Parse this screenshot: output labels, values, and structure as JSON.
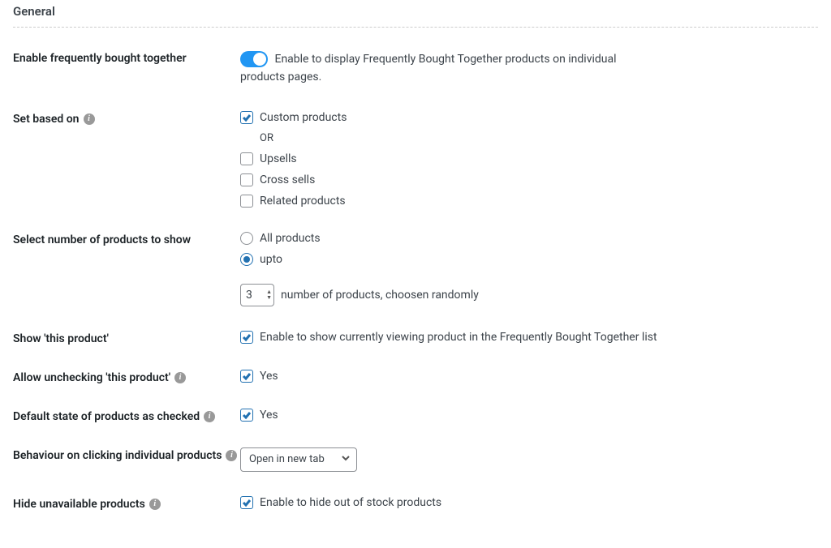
{
  "section_title": "General",
  "fields": {
    "enable_fbt": {
      "label": "Enable frequently bought together",
      "enabled": true,
      "description": "Enable to display Frequently Bought Together products on individual products pages."
    },
    "set_based_on": {
      "label": "Set based on",
      "options": {
        "custom": {
          "label": "Custom products",
          "checked": true
        },
        "or_text": "OR",
        "upsells": {
          "label": "Upsells",
          "checked": false
        },
        "cross_sells": {
          "label": "Cross sells",
          "checked": false
        },
        "related": {
          "label": "Related products",
          "checked": false
        }
      }
    },
    "select_number": {
      "label": "Select number of products to show",
      "options": {
        "all": {
          "label": "All products",
          "selected": false
        },
        "upto": {
          "label": "upto",
          "selected": true
        }
      },
      "number_value": "3",
      "number_suffix": "number of products, choosen randomly"
    },
    "show_this": {
      "label": "Show 'this product'",
      "checked": true,
      "text": "Enable to show currently viewing product in the Frequently Bought Together list"
    },
    "allow_uncheck": {
      "label": "Allow unchecking 'this product'",
      "checked": true,
      "text": "Yes"
    },
    "default_checked": {
      "label": "Default state of products as checked",
      "checked": true,
      "text": "Yes"
    },
    "click_behaviour": {
      "label": "Behaviour on clicking individual products",
      "selected": "Open in new tab"
    },
    "hide_unavailable": {
      "label": "Hide unavailable products",
      "checked": true,
      "text": "Enable to hide out of stock products"
    }
  }
}
